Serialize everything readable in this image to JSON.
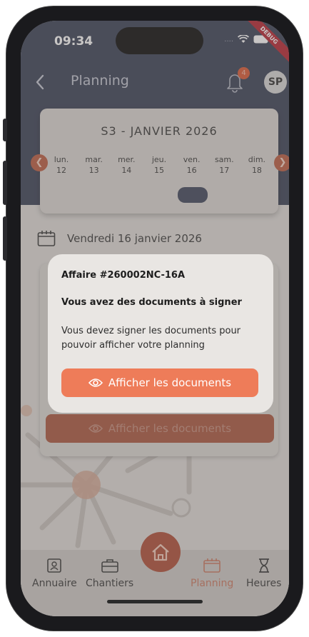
{
  "status": {
    "time": "09:34",
    "carrier_dots": "....",
    "debug": "DEBUG"
  },
  "header": {
    "title": "Planning",
    "notification_count": "4",
    "avatar_initials": "SP"
  },
  "week": {
    "title": "S3 - JANVIER 2026",
    "days": [
      {
        "name": "lun.",
        "num": "12"
      },
      {
        "name": "mar.",
        "num": "13"
      },
      {
        "name": "mer.",
        "num": "14"
      },
      {
        "name": "jeu.",
        "num": "15"
      },
      {
        "name": "ven.",
        "num": "16"
      },
      {
        "name": "sam.",
        "num": "17"
      },
      {
        "name": "dim.",
        "num": "18"
      }
    ],
    "prev_icon": "chevron-left-icon",
    "next_icon": "chevron-right-icon"
  },
  "selected_date": "Vendredi 16 janvier 2026",
  "background_button": "Afficher les documents",
  "modal": {
    "affaire": "Affaire #260002NC-16A",
    "heading": "Vous avez des documents à signer",
    "text": "Vous devez signer les documents pour pouvoir afficher votre planning",
    "button": "Afficher les documents"
  },
  "nav": {
    "annuaire": "Annuaire",
    "chantiers": "Chantiers",
    "planning": "Planning",
    "heures": "Heures"
  },
  "colors": {
    "header": "#353c52",
    "accent": "#ee7c59",
    "accent_dark": "#ad4a32",
    "nav_active": "#e07a5f"
  }
}
